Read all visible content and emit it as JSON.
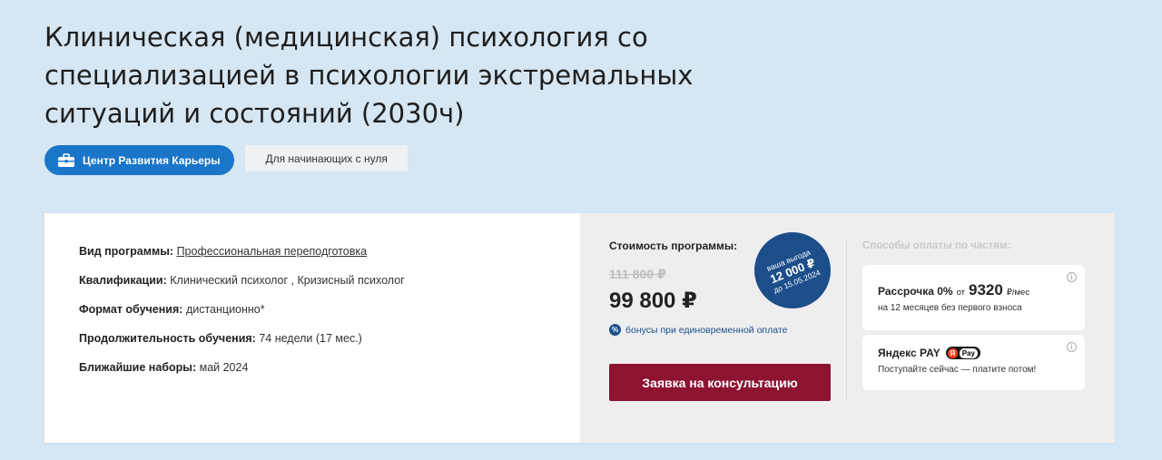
{
  "page": {
    "title": "Клиническая (медицинская) психология со специализацией в психологии экстремальных ситуаций и состояний (2030ч)"
  },
  "tags": {
    "primary": "Центр Развития Карьеры",
    "secondary": "Для начинающих с нуля"
  },
  "program": {
    "type_label": "Вид программы:",
    "type_value": "Профессиональная переподготовка",
    "qualification_label": "Квалификации:",
    "qualification_value": "Клинический психолог , Кризисный психолог",
    "format_label": "Формат обучения:",
    "format_value": "дистанционно*",
    "duration_label": "Продолжительность обучения:",
    "duration_value": "74 недели (17 мес.)",
    "enrollment_label": "Ближайшие наборы:",
    "enrollment_value": "май 2024"
  },
  "pricing": {
    "label": "Стоимость программы:",
    "old_price": "111 800 ₽",
    "new_price": "99 800 ₽",
    "bonus_text": "бонусы при единовременной оплате",
    "bonus_icon": "%",
    "badge_line1": "ваша выгода",
    "badge_line2": "12 000 ₽",
    "badge_line3": "до 15.05.2024",
    "cta_label": "Заявка на консультацию"
  },
  "payment": {
    "title": "Способы оплаты по частям:",
    "installment_label": "Рассрочка 0%",
    "installment_from": "от",
    "installment_amount": "9320",
    "installment_unit": "₽/мес",
    "installment_sub": "на 12 месяцев без первого взноса",
    "yandex_label": "Яндекс PAY",
    "yandex_logo_pay": "Pay",
    "yandex_sub": "Поступайте сейчас — платите потом!",
    "info_glyph": "i"
  },
  "colors": {
    "background": "#d6e6f2",
    "accent_blue": "#1a76c9",
    "badge_navy": "#1c4e8a",
    "cta_burgundy": "#8d1330"
  }
}
